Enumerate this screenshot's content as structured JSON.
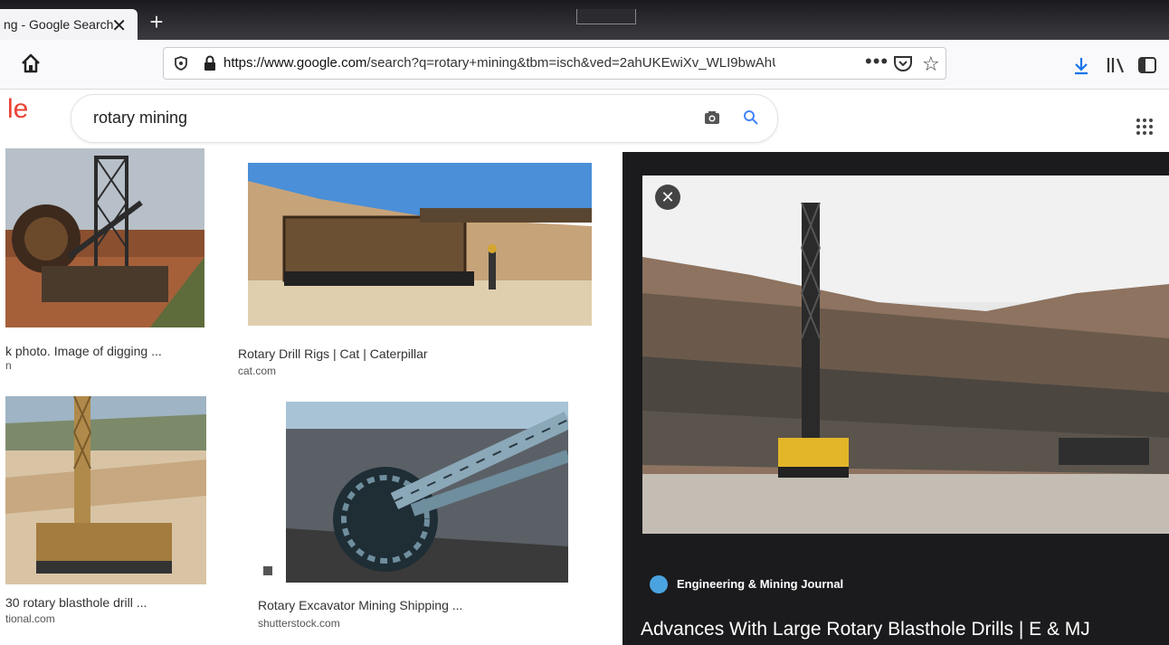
{
  "browser": {
    "tab_title": "ng - Google Search",
    "tab_close": "✕",
    "new_tab": "+",
    "url_host": "https://www.google.com",
    "url_rest": "/search?q=rotary+mining&tbm=isch&ved=2ahUKEwiXv_WLI9bwAhU",
    "url_more": "•••"
  },
  "google": {
    "logo_fragment": "le",
    "query": "rotary mining"
  },
  "results": [
    {
      "caption": "k photo. Image of digging ...",
      "source": "n"
    },
    {
      "caption": "Rotary Drill Rigs | Cat | Caterpillar",
      "source": "cat.com"
    },
    {
      "caption": "30 rotary blasthole drill ...",
      "source": "tional.com"
    },
    {
      "caption": "Rotary Excavator Mining Shipping ...",
      "source": "shutterstock.com"
    }
  ],
  "preview": {
    "source_name": "Engineering & Mining Journal",
    "title": "Advances With Large Rotary Blasthole Drills | E & MJ",
    "close": "✕"
  },
  "colors": {
    "panel_bg": "#1b1b1d",
    "google_red": "#ea4335",
    "download_blue": "#1a73e8"
  },
  "icons": [
    "home-icon",
    "shield-icon",
    "lock-icon",
    "pocket-icon",
    "star-icon",
    "download-icon",
    "library-icon",
    "sidebar-icon",
    "camera-icon",
    "search-icon",
    "apps-icon",
    "close-icon",
    "globe-icon"
  ]
}
